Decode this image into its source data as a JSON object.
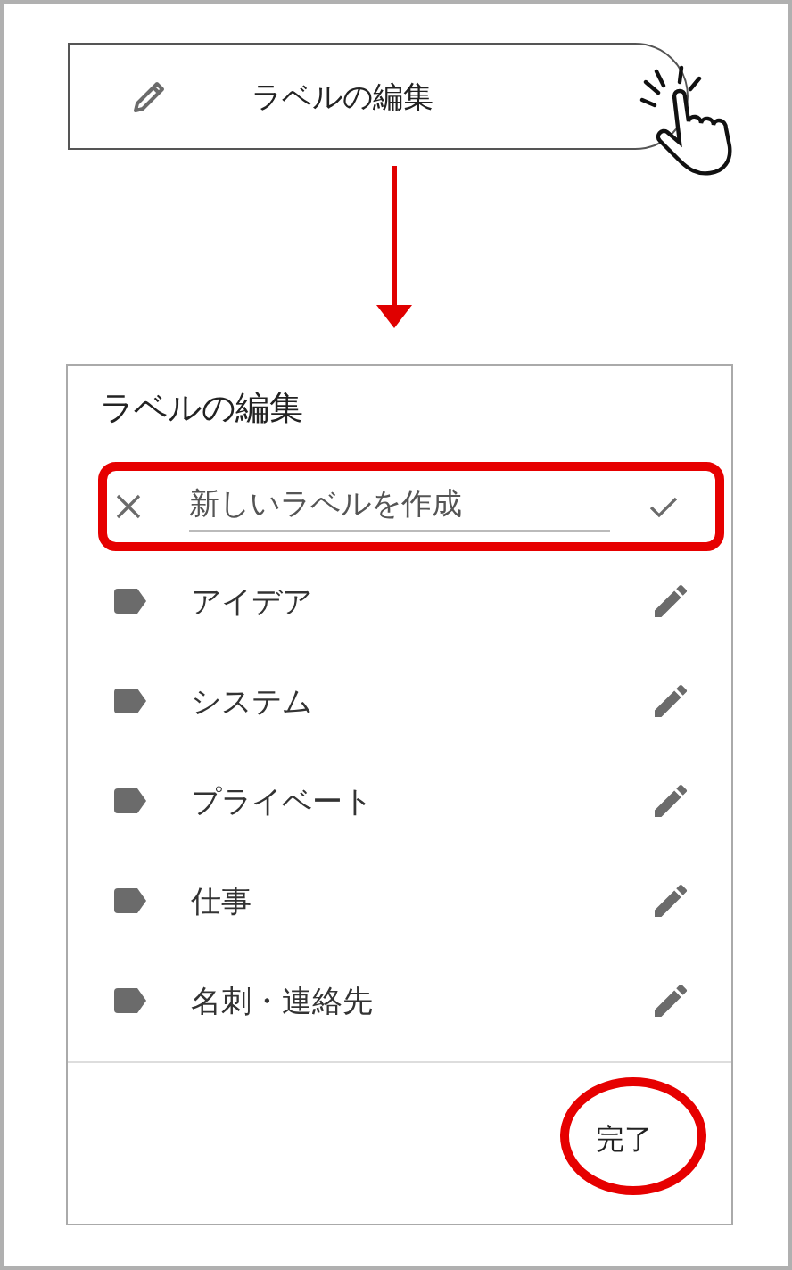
{
  "top_button": {
    "label": "ラベルの編集"
  },
  "dialog": {
    "title": "ラベルの編集",
    "new_label": {
      "placeholder": "新しいラベルを作成"
    },
    "labels": [
      {
        "name": "アイデア"
      },
      {
        "name": "システム"
      },
      {
        "name": "プライベート"
      },
      {
        "name": "仕事"
      },
      {
        "name": "名刺・連絡先"
      }
    ],
    "done_button": "完了"
  }
}
